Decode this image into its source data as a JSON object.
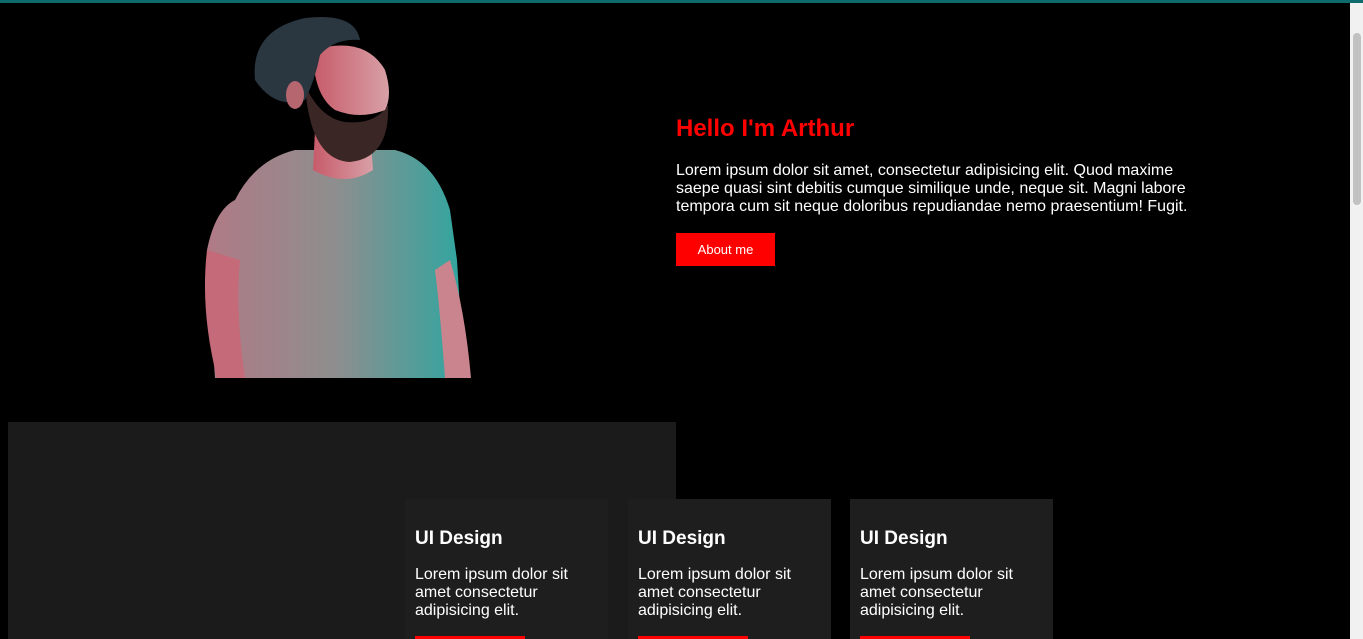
{
  "hero": {
    "title": "Hello I'm Arthur",
    "description": "Lorem ipsum dolor sit amet, consectetur adipisicing elit. Quod maxime saepe quasi sint debitis cumque similique unde, neque sit. Magni labore tempora cum sit neque doloribus repudiandae nemo praesentium! Fugit.",
    "button_label": "About me",
    "portrait_icon": "person-portrait-icon"
  },
  "services": {
    "cards": [
      {
        "title": "UI Design",
        "description": "Lorem ipsum dolor sit amet consectetur adipisicing elit."
      },
      {
        "title": "UI Design",
        "description": "Lorem ipsum dolor sit amet consectetur adipisicing elit."
      },
      {
        "title": "UI Design",
        "description": "Lorem ipsum dolor sit amet consectetur adipisicing elit."
      }
    ]
  },
  "colors": {
    "accent": "#ff0000",
    "background": "#000000",
    "panel": "#1b1b1b",
    "card": "#1e1e1e",
    "top_bar": "#0e6b6b"
  }
}
